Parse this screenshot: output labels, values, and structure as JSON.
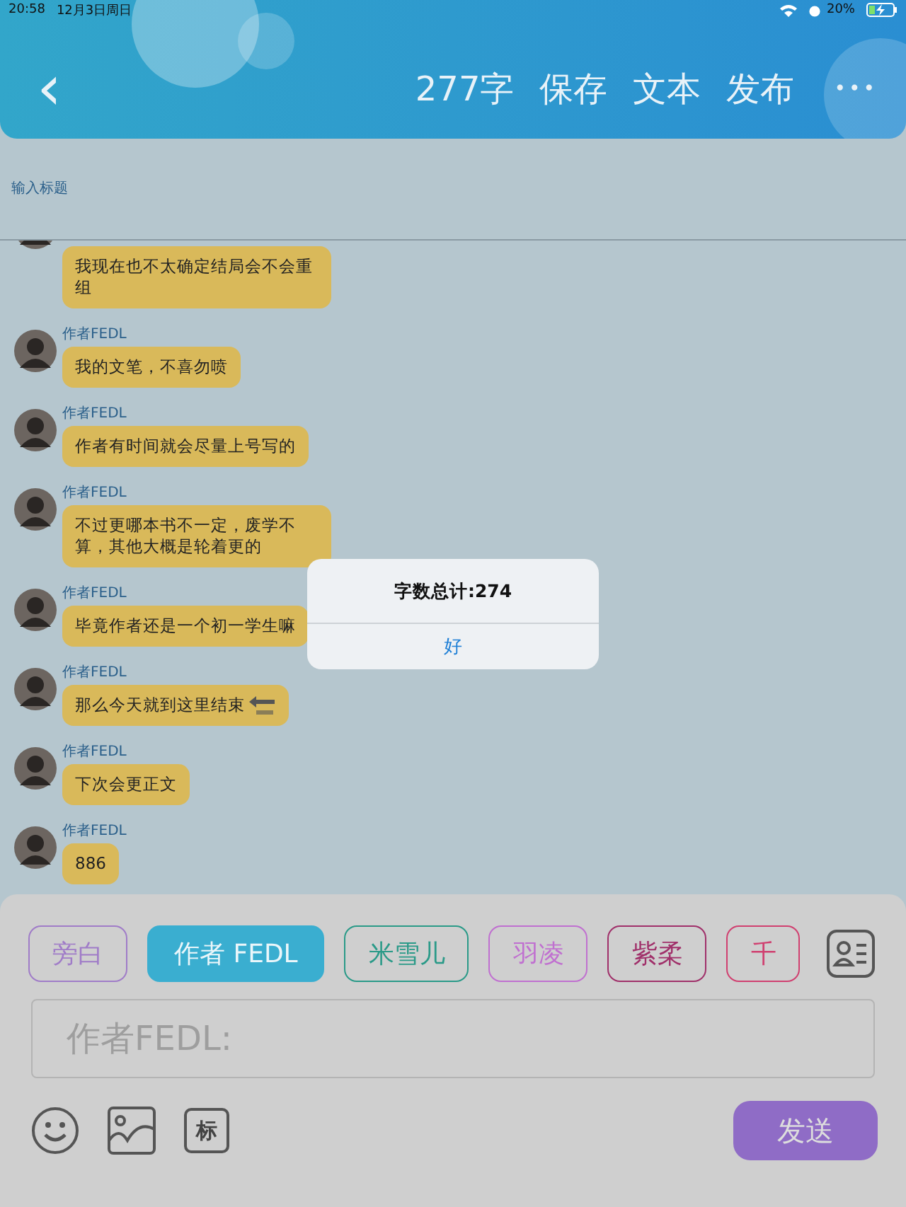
{
  "status_bar": {
    "time": "20:58",
    "date": "12月3日周日",
    "battery": "20%"
  },
  "header": {
    "back": "‹",
    "actions": [
      "277字",
      "保存",
      "文本",
      "发布"
    ],
    "more": "•••"
  },
  "title_field": {
    "placeholder": "输入标题"
  },
  "messages": [
    {
      "text": "我现在也不太确定结局会不会重组",
      "end_icon": false
    },
    {
      "sender": "作者FEDL",
      "text": "我的文笔，不喜勿喷",
      "end_icon": false
    },
    {
      "sender": "作者FEDL",
      "text": "作者有时间就会尽量上号写的",
      "end_icon": false
    },
    {
      "sender": "作者FEDL",
      "text": "不过更哪本书不一定，废学不算，其他大概是轮着更的",
      "end_icon": false
    },
    {
      "sender": "作者FEDL",
      "text": "毕竟作者还是一个初一学生嘛",
      "end_icon": false
    },
    {
      "sender": "作者FEDL",
      "text": "那么今天就到这里结束",
      "end_icon": true
    },
    {
      "sender": "作者FEDL",
      "text": "下次会更正文",
      "end_icon": false
    },
    {
      "sender": "作者FEDL",
      "text": "886",
      "end_icon": false
    }
  ],
  "characters": [
    {
      "label": "旁白",
      "color": "#a07cc8",
      "selected": false
    },
    {
      "label": "作者 FEDL",
      "color": "#3aaed0",
      "selected": true
    },
    {
      "label": "米雪儿",
      "color": "#2a9a88",
      "selected": false
    },
    {
      "label": "羽凌",
      "color": "#c070d0",
      "selected": false
    },
    {
      "label": "紫柔",
      "color": "#a0306a",
      "selected": false
    },
    {
      "label": "千",
      "color": "#d04070",
      "selected": false
    }
  ],
  "input": {
    "placeholder": "作者FEDL:"
  },
  "tools": {
    "tag": "标"
  },
  "send_button": "发送",
  "alert": {
    "message": "字数总计:274",
    "button": "好"
  }
}
